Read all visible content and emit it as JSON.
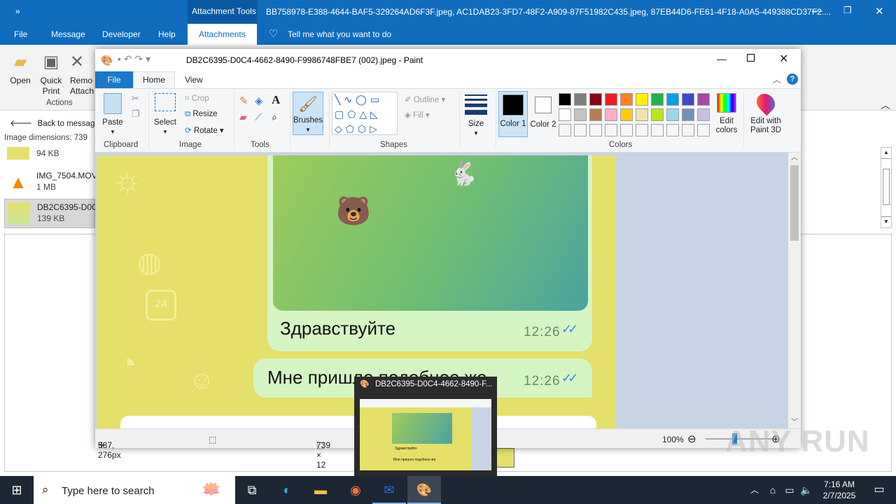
{
  "outlook": {
    "title_group": "Attachment Tools",
    "title": "BB758978-E388-4644-BAF5-329264AD6F3F.jpeg, AC1DAB23-3FD7-48F2-A909-87F51982C435.jpeg, 87EB44D6-FE61-4F18-A0A5-449388CD37F2....",
    "tabs": [
      "File",
      "Message",
      "Developer",
      "Help",
      "Attachments"
    ],
    "tell_me": "Tell me what you want to do",
    "ribbon": {
      "open": "Open",
      "quick_print": "Quick Print",
      "remove": "Remo Attach",
      "group_actions": "Actions"
    },
    "back": "Back to message",
    "image_dimensions": "Image dimensions: 739",
    "attachments": [
      {
        "name": "",
        "size": "94 KB"
      },
      {
        "name": "IMG_7504.MOV",
        "size": "1 MB"
      },
      {
        "name": "DB2C6395-D0C",
        "size": "139 KB"
      }
    ]
  },
  "paint": {
    "title": "DB2C6395-D0C4-4662-8490-F9986748FBE7 (002).jpeg - Paint",
    "tabs": {
      "file": "File",
      "home": "Home",
      "view": "View"
    },
    "clipboard": {
      "paste": "Paste",
      "group": "Clipboard"
    },
    "image": {
      "select": "Select",
      "crop": "Crop",
      "resize": "Resize",
      "rotate": "Rotate",
      "group": "Image"
    },
    "tools": {
      "group": "Tools"
    },
    "brushes": "Brushes",
    "shapes": {
      "outline": "Outline",
      "fill": "Fill",
      "group": "Shapes"
    },
    "size": "Size",
    "colors": {
      "color1": "Color 1",
      "color2": "Color 2",
      "group": "Colors",
      "edit": "Edit colors",
      "paint3d": "Edit with Paint 3D",
      "palette": [
        "#000000",
        "#7f7f7f",
        "#880015",
        "#ed1c24",
        "#ff7f27",
        "#fff200",
        "#22b14c",
        "#00a2e8",
        "#3f48cc",
        "#a349a4",
        "#ffffff",
        "#c3c3c3",
        "#b97a57",
        "#ffaec9",
        "#ffc90e",
        "#efe4b0",
        "#b5e61d",
        "#99d9ea",
        "#7092be",
        "#c8bfe7",
        "#f5f6f7",
        "#f5f6f7",
        "#f5f6f7",
        "#f5f6f7",
        "#f5f6f7",
        "#f5f6f7",
        "#f5f6f7",
        "#f5f6f7",
        "#f5f6f7",
        "#f5f6f7"
      ]
    },
    "chat": {
      "msg1": "Здравствуйте",
      "time1": "12:26",
      "msg2": "Мне пришло подобное же",
      "time2": "12:26",
      "date_badge": "24"
    },
    "status": {
      "pos": "587, 276px",
      "dims": "739 × 12",
      "zoom": "100%"
    }
  },
  "thumbnail": {
    "title": "DB2C6395-D0C4-4662-8490-F...",
    "msg1": "Здравствуйте",
    "msg2": "Мне пришло подобное же"
  },
  "taskbar": {
    "search": "Type here to search",
    "time": "7:16 AM",
    "date": "2/7/2025"
  },
  "watermark": "ANY RUN"
}
